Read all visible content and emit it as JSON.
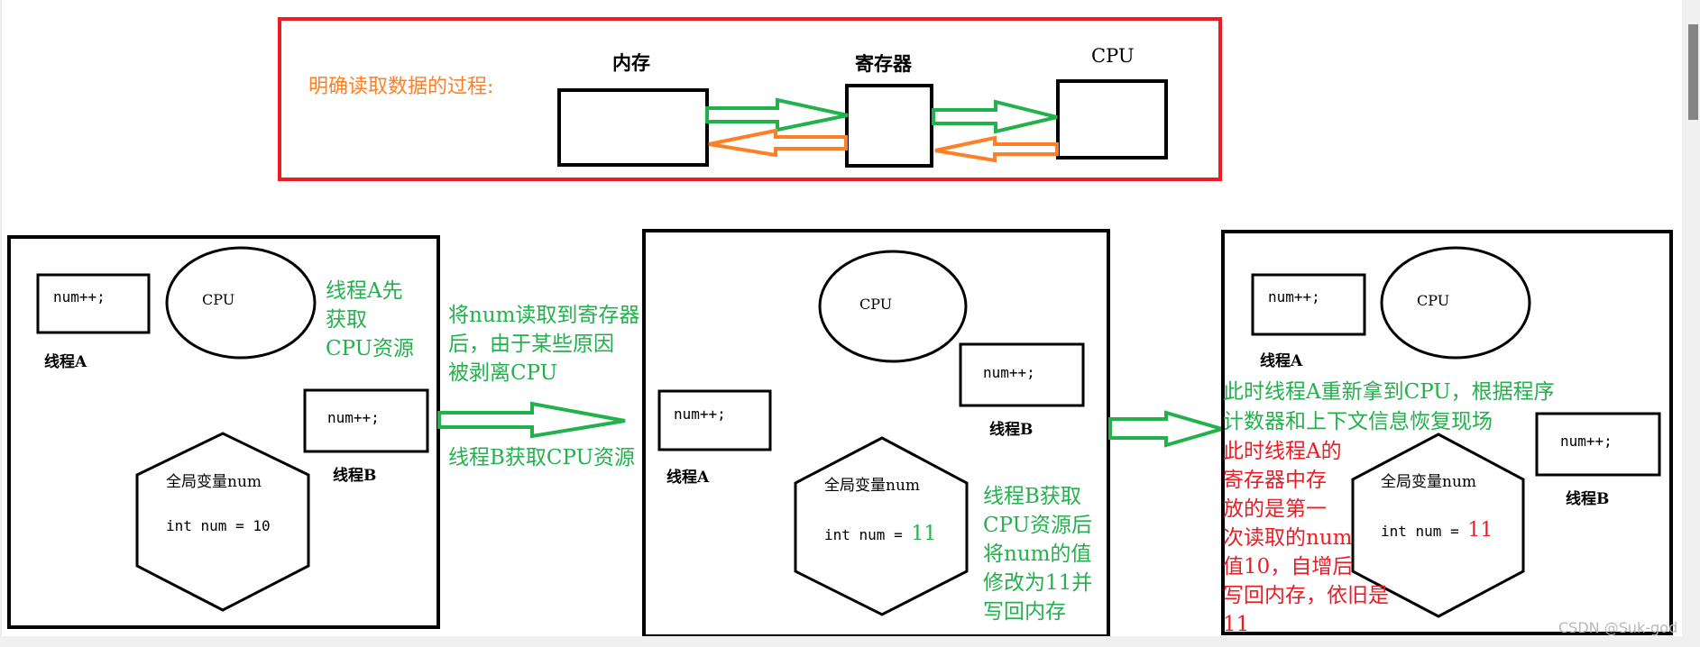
{
  "top_panel": {
    "title": "明确读取数据的过程:",
    "memory_label": "内存",
    "register_label": "寄存器",
    "cpu_label": "CPU",
    "colors": {
      "frame": "#ed1c24",
      "load_arrow": "#22b14c",
      "store_arrow": "#ff7f27"
    }
  },
  "panels": [
    {
      "cpu_label": "CPU",
      "thread_a": {
        "code": "num++;",
        "label": "线程A"
      },
      "thread_b": {
        "code": "num++;",
        "label": "线程B"
      },
      "global_var": {
        "title": "全局变量num",
        "decl": "int num = ",
        "value": "10"
      },
      "note_lines": [
        "线程A先",
        "获取",
        "CPU资源"
      ]
    },
    {
      "cpu_label": "CPU",
      "thread_a": {
        "code": "num++;",
        "label": "线程A"
      },
      "thread_b": {
        "code": "num++;",
        "label": "线程B"
      },
      "global_var": {
        "title": "全局变量num",
        "decl": "int num = ",
        "value": "11"
      },
      "note_lines": [
        "线程B获取",
        "CPU资源后",
        "将num的值",
        "修改为11并",
        "写回内存"
      ]
    },
    {
      "cpu_label": "CPU",
      "thread_a": {
        "code": "num++;",
        "label": "线程A"
      },
      "thread_b": {
        "code": "num++;",
        "label": "线程B"
      },
      "global_var": {
        "title": "全局变量num",
        "decl": "int num = ",
        "value": "11"
      },
      "note_lines": [
        "此时线程A重新拿到CPU，根据程序",
        "计数器和上下文信息恢复现场"
      ],
      "red_note_lines": [
        "此时线程A的",
        "寄存器中存",
        "放的是第一",
        "次读取的num",
        "值10，自增后",
        "写回内存，依旧是",
        "11"
      ]
    }
  ],
  "transition_1": {
    "above_lines": [
      "将num读取到寄存器",
      "后，由于某些原因",
      "被剥离CPU"
    ],
    "below": "线程B获取CPU资源"
  },
  "watermark": "CSDN @Suk-god"
}
